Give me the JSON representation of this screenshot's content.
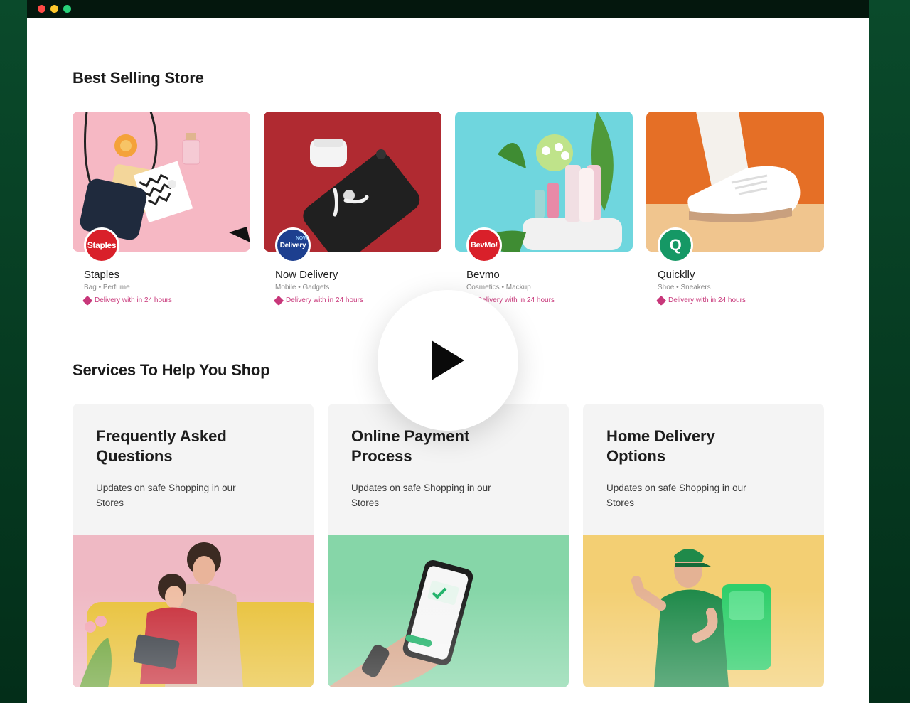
{
  "sections": {
    "best_selling_title": "Best Selling Store",
    "services_title": "Services To Help You Shop"
  },
  "stores": [
    {
      "name": "Staples",
      "categories": "Bag • Perfume",
      "delivery": "Delivery with in 24 hours",
      "logo_text": "Staples",
      "logo_color": "#d9202a",
      "bg": "#f6b8c4"
    },
    {
      "name": "Now Delivery",
      "categories": "Mobile • Gadgets",
      "delivery": "Delivery with in 24 hours",
      "logo_text": "Delivery",
      "logo_sup": "NOW",
      "logo_color": "#1d3f8f",
      "bg": "#a8242b"
    },
    {
      "name": "Bevmo",
      "categories": "Cosmetics • Mackup",
      "delivery": "Delivery with in 24 hours",
      "logo_text": "BevMo!",
      "logo_color": "#d9202a",
      "bg": "#6fd6de"
    },
    {
      "name": "Quicklly",
      "categories": "Shoe • Sneakers",
      "delivery": "Delivery with in 24 hours",
      "logo_text": "Q",
      "logo_color": "#159865",
      "bg": "#e56f26"
    }
  ],
  "services": [
    {
      "title": "Frequently Asked Questions",
      "desc": "Updates on safe Shopping in our Stores",
      "bg": "#efb9c4"
    },
    {
      "title": "Online Payment Process",
      "desc": "Updates on safe Shopping in our Stores",
      "bg": "#86d6a8"
    },
    {
      "title": "Home Delivery Options",
      "desc": "Updates on safe Shopping in our Stores",
      "bg": "#f3cf73"
    }
  ],
  "icons": {
    "play": "play-icon",
    "tag": "tag-icon"
  }
}
